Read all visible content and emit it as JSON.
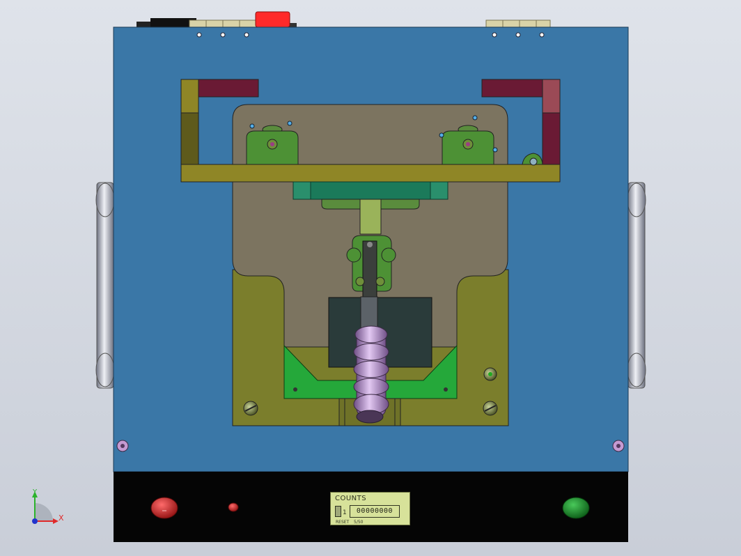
{
  "counter": {
    "title": "COUNTS",
    "value": "00000000",
    "digit_label": "1",
    "sub_label_left": "RESET",
    "sub_label_right": "5/50"
  },
  "triad": {
    "x_label": "X",
    "y_label": "Y"
  },
  "colors": {
    "background": "#dfe3ea",
    "base_plate": "#3a77a7",
    "control_panel": "#050505",
    "stop_button": "#c42222",
    "start_button": "#1e8a2a",
    "emergency_stop": "#ff2a2a",
    "frame_yellow": "#8f8626",
    "handle_lilac": "#b58fcf"
  }
}
